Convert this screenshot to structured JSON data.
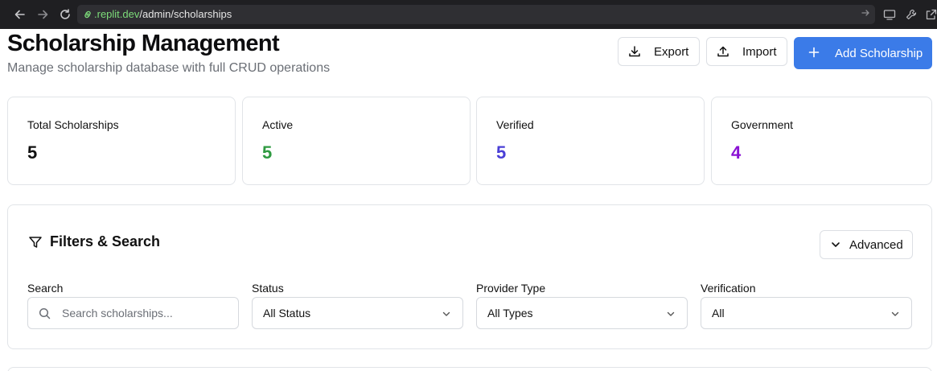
{
  "browser": {
    "url_host": ".replit.dev",
    "url_path": "/admin/scholarships"
  },
  "header": {
    "title": "Scholarship Management",
    "subtitle": "Manage scholarship database with full CRUD operations",
    "export_label": "Export",
    "import_label": "Import",
    "add_label": "Add Scholarship"
  },
  "stats": [
    {
      "label": "Total Scholarships",
      "value": "5",
      "color": "#111111"
    },
    {
      "label": "Active",
      "value": "5",
      "color": "#2f9a41"
    },
    {
      "label": "Verified",
      "value": "5",
      "color": "#4a3fd6"
    },
    {
      "label": "Government",
      "value": "4",
      "color": "#8a12d4"
    }
  ],
  "filters": {
    "title": "Filters & Search",
    "advanced_label": "Advanced",
    "search": {
      "label": "Search",
      "placeholder": "Search scholarships..."
    },
    "status": {
      "label": "Status",
      "value": "All Status"
    },
    "provider": {
      "label": "Provider Type",
      "value": "All Types"
    },
    "verification": {
      "label": "Verification",
      "value": "All"
    }
  },
  "colors": {
    "primary": "#3b7be8"
  }
}
